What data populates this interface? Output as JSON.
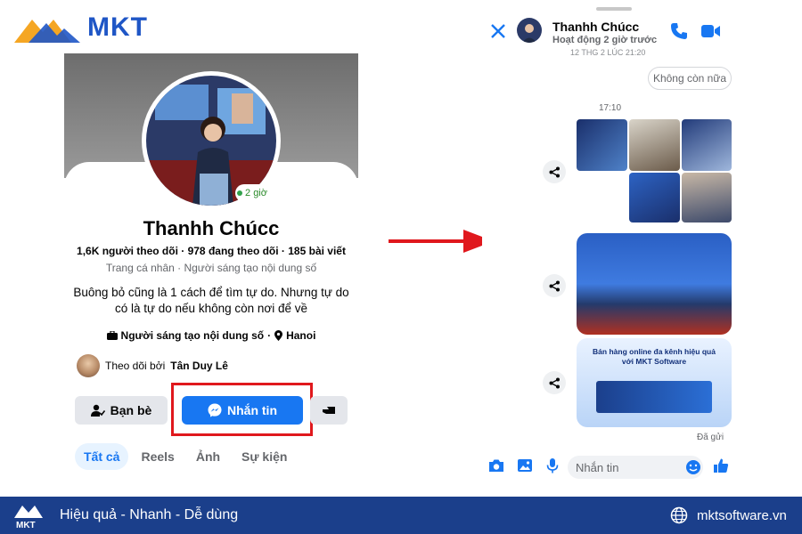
{
  "brand": {
    "name": "MKT",
    "colors": {
      "primary": "#1f56c6",
      "accent": "#f5a623",
      "messenger": "#1877f2",
      "highlight": "#e0181d"
    }
  },
  "profile": {
    "online_badge": "2 giờ",
    "name": "Thanhh Chúcc",
    "stats": "1,6K người theo dõi · 978 đang theo dõi · 185 bài viết",
    "subtitle": "Trang cá nhân · Người sáng tạo nội dung số",
    "bio": "Buông bỏ cũng là 1 cách để tìm tự do. Nhưng tự do có là tự do nếu không còn nơi để về",
    "category": "Người sáng tạo nội dung số",
    "location": "Hanoi",
    "followed_by_prefix": "Theo dõi bởi",
    "followed_by_name": "Tân Duy Lê",
    "buttons": {
      "friends": "Bạn bè",
      "message": "Nhắn tin"
    },
    "tabs": [
      "Tất cả",
      "Reels",
      "Ảnh",
      "Sự kiện"
    ]
  },
  "chat": {
    "contact_name": "Thanhh Chúcc",
    "status": "Hoạt động 2 giờ trước",
    "date_stamp": "12 THG 2 LÚC 21:20",
    "last_message": "Không còn nữa",
    "time": "17:10",
    "promo_banner_title": "Bán hàng online đa kênh hiệu quả với MKT Software",
    "sent_status": "Đã gửi",
    "composer_placeholder": "Nhắn tin"
  },
  "footer": {
    "slogan": "Hiệu quả - Nhanh - Dễ dùng",
    "website": "mktsoftware.vn"
  }
}
